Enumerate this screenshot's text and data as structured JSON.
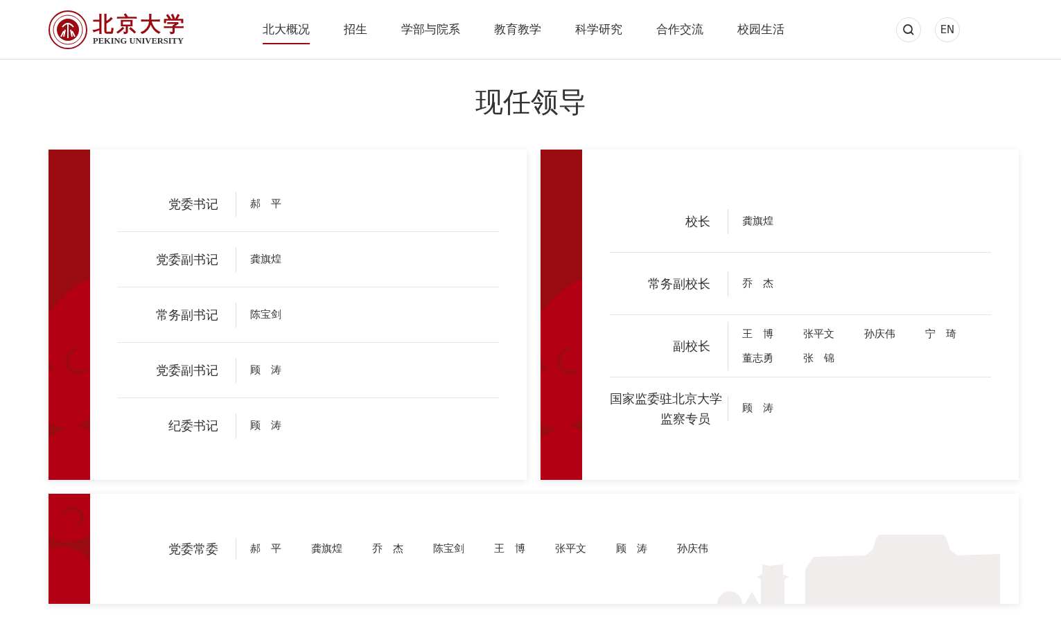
{
  "header": {
    "logo": {
      "chinese": "北京大学",
      "english": "PEKING UNIVERSITY"
    },
    "nav": [
      {
        "label": "北大概况",
        "selected": true
      },
      {
        "label": "招生",
        "selected": false
      },
      {
        "label": "学部与院系",
        "selected": false
      },
      {
        "label": "教育教学",
        "selected": false
      },
      {
        "label": "科学研究",
        "selected": false
      },
      {
        "label": "合作交流",
        "selected": false
      },
      {
        "label": "校园生活",
        "selected": false
      }
    ],
    "language_button": "EN"
  },
  "page_title": "现任领导",
  "panels": [
    {
      "rows": [
        {
          "title": "党委书记",
          "names": [
            "郝　平"
          ]
        },
        {
          "title": "党委副书记",
          "names": [
            "龚旗煌"
          ]
        },
        {
          "title": "常务副书记",
          "names": [
            "陈宝剑"
          ]
        },
        {
          "title": "党委副书记",
          "names": [
            "顾　涛"
          ]
        },
        {
          "title": "纪委书记",
          "names": [
            "顾　涛"
          ]
        }
      ]
    },
    {
      "rows": [
        {
          "title": "校长",
          "names": [
            "龚旗煌"
          ]
        },
        {
          "title": "常务副校长",
          "names": [
            "乔　杰"
          ]
        },
        {
          "title": "副校长",
          "names": [
            "王　博",
            "张平文",
            "孙庆伟",
            "宁　琦",
            "董志勇",
            "张　锦"
          ]
        },
        {
          "title": "国家监委驻北京大学监察专员",
          "names": [
            "顾　涛"
          ]
        }
      ]
    }
  ],
  "committee": {
    "title": "党委常委",
    "names": [
      "郝　平",
      "龚旗煌",
      "乔　杰",
      "陈宝剑",
      "王　博",
      "张平文",
      "顾　涛",
      "孙庆伟"
    ]
  }
}
